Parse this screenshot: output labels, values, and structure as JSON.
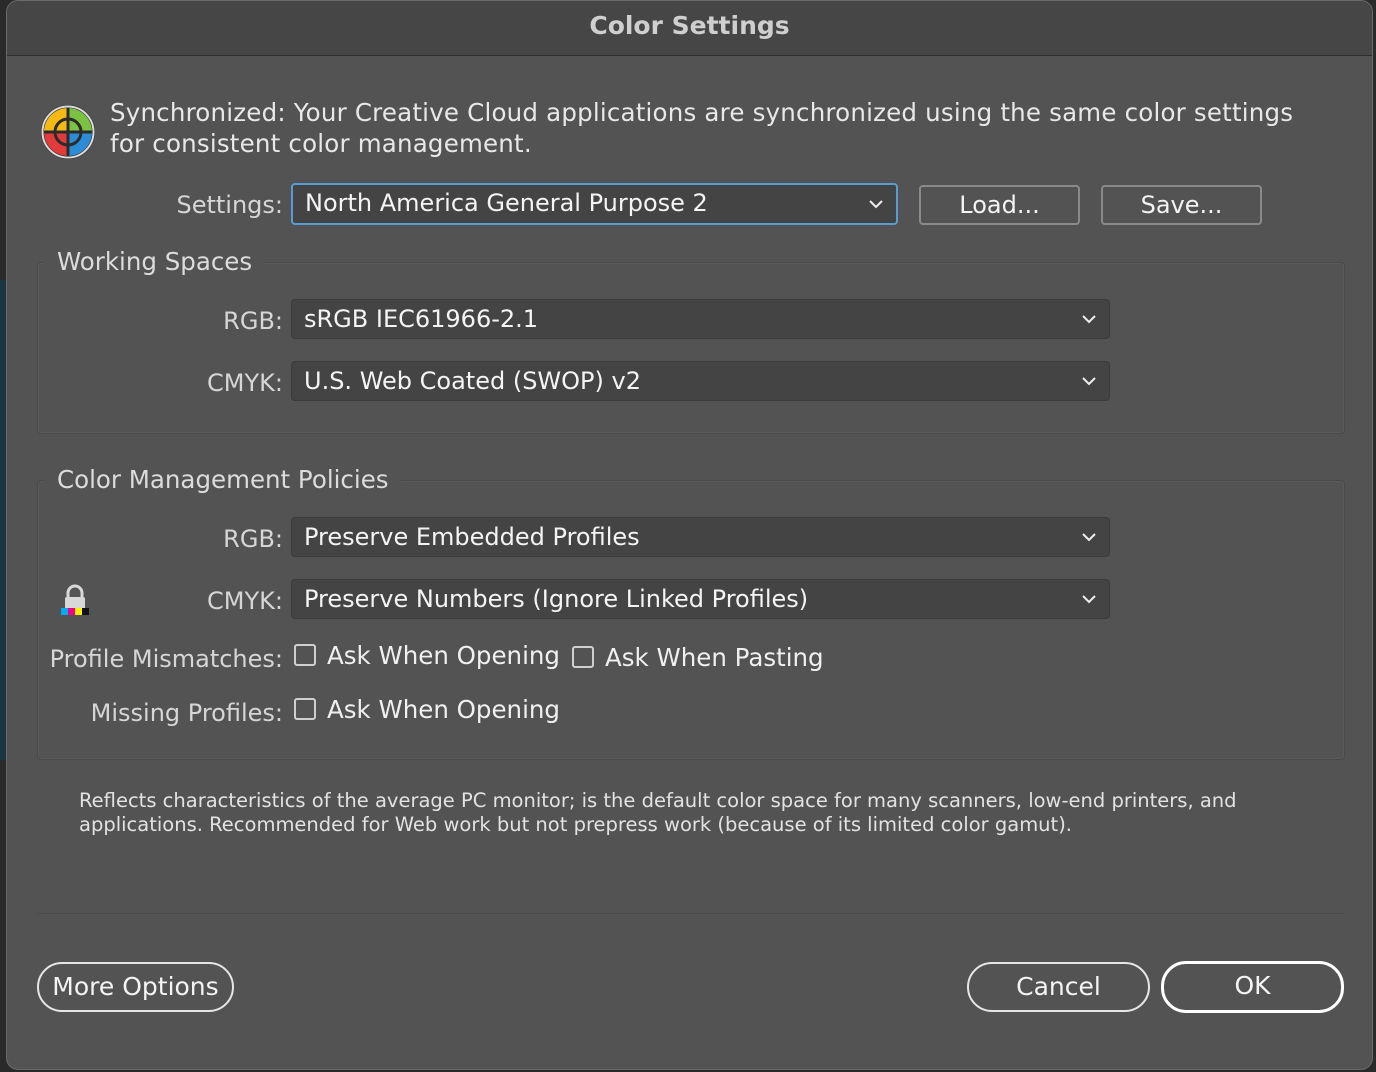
{
  "window": {
    "title": "Color Settings"
  },
  "sync": {
    "icon": "color-wheel-icon",
    "message": "Synchronized: Your Creative Cloud applications are synchronized using the same color settings for consistent color management."
  },
  "settings": {
    "label": "Settings:",
    "value": "North America General Purpose 2",
    "load_label": "Load...",
    "save_label": "Save..."
  },
  "working_spaces": {
    "title": "Working Spaces",
    "rgb_label": "RGB:",
    "rgb_value": "sRGB IEC61966-2.1",
    "cmyk_label": "CMYK:",
    "cmyk_value": "U.S. Web Coated (SWOP) v2"
  },
  "policies": {
    "title": "Color Management Policies",
    "rgb_label": "RGB:",
    "rgb_value": "Preserve Embedded Profiles",
    "cmyk_label": "CMYK:",
    "cmyk_value": "Preserve Numbers (Ignore Linked Profiles)",
    "lock_icon": "lock-icon",
    "profile_mismatches_label": "Profile Mismatches:",
    "mismatch_opening_label": "Ask When Opening",
    "mismatch_opening_checked": false,
    "mismatch_pasting_label": "Ask When Pasting",
    "mismatch_pasting_checked": false,
    "missing_profiles_label": "Missing Profiles:",
    "missing_opening_label": "Ask When Opening",
    "missing_opening_checked": false
  },
  "description": "Reflects characteristics of the average PC monitor; is the default color space for many scanners, low-end printers, and applications. Recommended for Web work but not prepress work (because of its limited color gamut).",
  "footer": {
    "more_options_label": "More Options",
    "cancel_label": "Cancel",
    "ok_label": "OK"
  },
  "colors": {
    "dialog_bg": "#535353",
    "focus_ring": "#5b9bd5"
  }
}
